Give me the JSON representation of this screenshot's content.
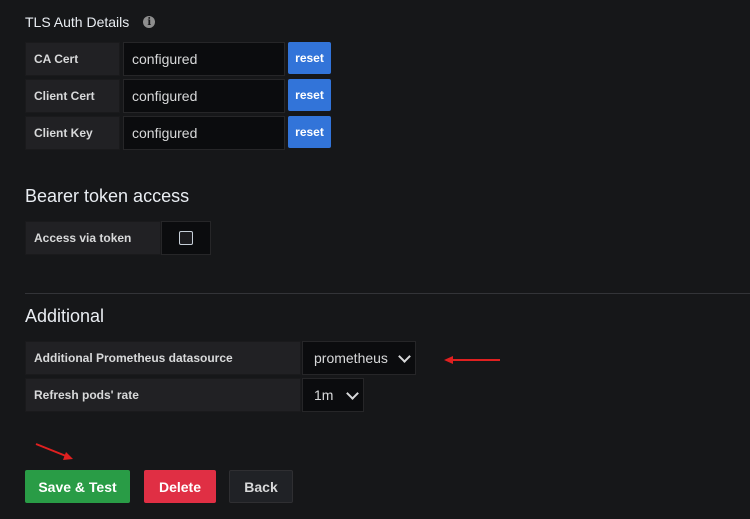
{
  "tls": {
    "title": "TLS Auth Details",
    "rows": [
      {
        "label": "CA Cert",
        "value": "configured",
        "button": "reset"
      },
      {
        "label": "Client Cert",
        "value": "configured",
        "button": "reset"
      },
      {
        "label": "Client Key",
        "value": "configured",
        "button": "reset"
      }
    ]
  },
  "bearer": {
    "title": "Bearer token access",
    "access_label": "Access via token",
    "checked": false
  },
  "additional": {
    "title": "Additional",
    "datasource_label": "Additional Prometheus datasource",
    "datasource_value": "prometheus",
    "refresh_label": "Refresh pods' rate",
    "refresh_value": "1m"
  },
  "actions": {
    "save": "Save & Test",
    "delete": "Delete",
    "back": "Back"
  },
  "colors": {
    "primary": "#3274d9",
    "success": "#299c46",
    "danger": "#e02f44",
    "annotation": "#e02020"
  }
}
